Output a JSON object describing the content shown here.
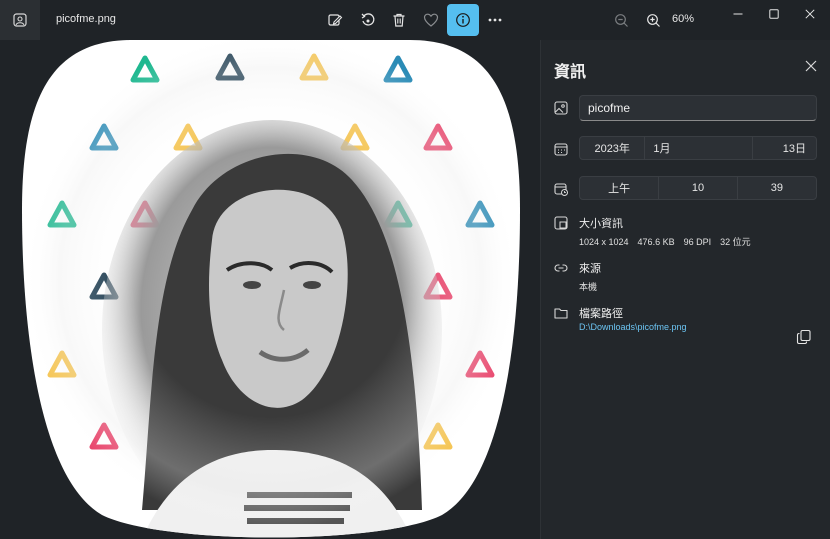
{
  "app": {
    "filename": "picofme.png",
    "zoom": "60%"
  },
  "toolbar": {
    "items": [
      "edit-image-icon",
      "rotate-icon",
      "delete-icon",
      "favorite-icon",
      "info-icon",
      "more-icon"
    ],
    "active": "info-icon",
    "accent": "#55bff0"
  },
  "window": {
    "controls": [
      "minimize",
      "maximize",
      "close"
    ]
  },
  "panel": {
    "title": "資訊",
    "name_value": "picofme",
    "date": {
      "year": "2023年",
      "month": "1月",
      "day": "13日"
    },
    "time": {
      "ampm": "上午",
      "hour": "10",
      "minute": "39"
    },
    "size": {
      "title": "大小資訊",
      "dimensions": "1024 x 1024",
      "filesize": "476.6 KB",
      "dpi": "96 DPI",
      "bitdepth": "32 位元"
    },
    "source": {
      "title": "來源",
      "value": "本機"
    },
    "path": {
      "title": "檔案路徑",
      "value": "D:\\Downloads\\picofme.png"
    }
  }
}
